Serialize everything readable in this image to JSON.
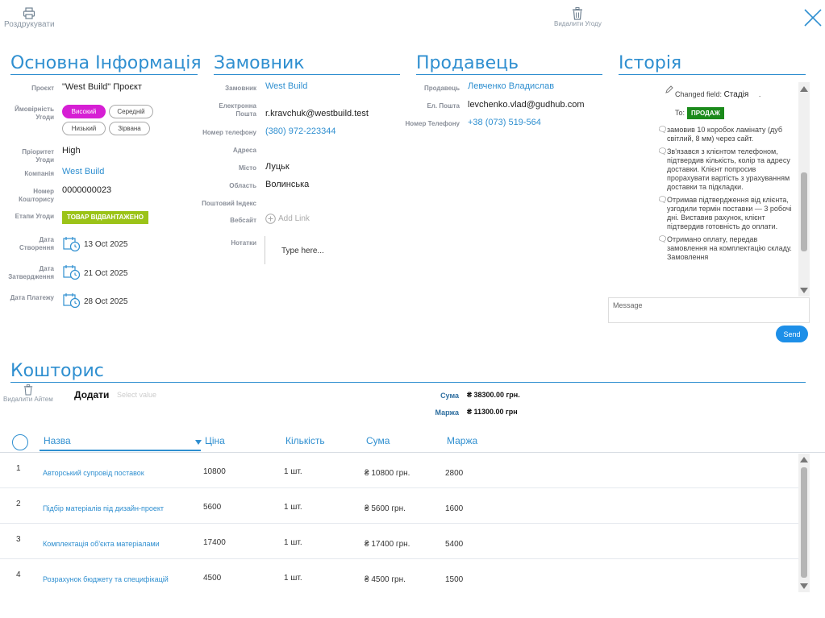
{
  "toolbar": {
    "print_label": "Роздрукувати",
    "delete_deal_label": "Видалити Угоду"
  },
  "sections": {
    "main_info": "Основна Інформація",
    "customer": "Замовник",
    "seller": "Продавець",
    "history": "Історія",
    "estimate": "Кошторис"
  },
  "main_info": {
    "project_label": "Проєкт",
    "project_value": "\"West Build\" Проєкт",
    "probability_label": "Ймовірність Угоди",
    "probability_options": [
      "Високий",
      "Середній",
      "Низький",
      "Зірвана"
    ],
    "probability_selected": "Високий",
    "priority_label": "Пріоритет Угоди",
    "priority_value": "High",
    "company_label": "Компанія",
    "company_value": "West Build",
    "estimate_number_label": "Номер Кошторису",
    "estimate_number_value": "0000000023",
    "stage_label": "Етапи Угоди",
    "stage_value": "ТОВАР ВІДВАНТАЖЕНО",
    "created_label": "Дата Створення",
    "created_value": "13 Oct 2025",
    "approved_label": "Дата Затвердження",
    "approved_value": "21 Oct 2025",
    "payment_label": "Дата Платежу",
    "payment_value": "28 Oct 2025"
  },
  "customer": {
    "customer_label": "Замовник",
    "customer_value": "West Build",
    "email_label": "Електронна Пошта",
    "email_value": "r.kravchuk@westbuild.test",
    "phone_label": "Номер телефону",
    "phone_value": "(380) 972-223344",
    "address_label": "Адреса",
    "city_label": "Місто",
    "city_value": "Луцьк",
    "region_label": "Область",
    "region_value": "Волинська",
    "postal_label": "Поштовий Індекс",
    "website_label": "Вебсайт",
    "website_add": "Add Link",
    "notes_label": "Нотатки",
    "notes_placeholder": "Type here..."
  },
  "seller": {
    "seller_label": "Продавець",
    "seller_value": "Левченко Владислав",
    "email_label": "Ел. Пошта",
    "email_value": "levchenko.vlad@gudhub.com",
    "phone_label": "Номер Телефону",
    "phone_value": "+38 (073) 519-564"
  },
  "history": {
    "changed_field_prefix": "Changed field:",
    "changed_field_value": "Стадія",
    "changed_field_suffix": ".",
    "to_label": "To:",
    "to_badge": "ПРОДАЖ",
    "entries": [
      "замовив 10 коробок ламінату (дуб світлий, 8 мм) через сайт.",
      "Зв'язався з клієнтом телефоном, підтвердив кількість, колір та адресу доставки. Клієнт попросив прорахувати вартість з урахуванням доставки та підкладки.",
      "Отримав підтвердження від клієнта, узгодили термін поставки — 3 робочі дні. Виставив рахунок, клієнт підтвердив готовність до оплати.",
      "Отримано оплату, передав замовлення на комплектацію складу. Замовлення"
    ],
    "message_placeholder": "Message",
    "send_label": "Send"
  },
  "estimate": {
    "delete_item_label": "Видалити Айтем",
    "add_label": "Додати",
    "select_placeholder": "Select value",
    "sum_label": "Сума",
    "sum_value": "₴ 38300.00 грн.",
    "margin_label": "Маржа",
    "margin_value": "₴ 11300.00 грн",
    "columns": [
      "Назва",
      "Ціна",
      "Кількість",
      "Сума",
      "Маржа"
    ],
    "rows": [
      {
        "num": "1",
        "name": "Авторський супровід поставок",
        "price": "10800",
        "qty": "1 шт.",
        "sum": "₴ 10800 грн.",
        "margin": "2800"
      },
      {
        "num": "2",
        "name": "Підбір матеріалів під дизайн-проект",
        "price": "5600",
        "qty": "1 шт.",
        "sum": "₴ 5600 грн.",
        "margin": "1600"
      },
      {
        "num": "3",
        "name": "Комплектація об'єкта матеріалами",
        "price": "17400",
        "qty": "1 шт.",
        "sum": "₴ 17400 грн.",
        "margin": "5400"
      },
      {
        "num": "4",
        "name": "Розрахунок бюджету та специфікацій",
        "price": "4500",
        "qty": "1 шт.",
        "sum": "₴ 4500 грн.",
        "margin": "1500"
      }
    ]
  },
  "colors": {
    "accent": "#2f8fd0",
    "probability_active": "#d61fd4",
    "stage_badge": "#9bc318",
    "history_badge": "#1b8a1b",
    "send_button": "#1d8fe8"
  },
  "icons": [
    "printer-icon",
    "trash-icon",
    "close-icon",
    "calendar-icon",
    "pencil-icon",
    "comment-icon",
    "plus-circle-icon"
  ]
}
